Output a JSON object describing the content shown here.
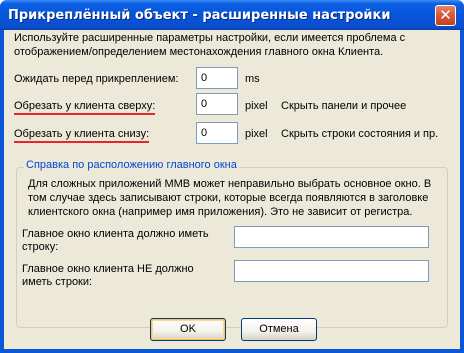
{
  "window": {
    "title": "Прикреплённый объект - расширенные настройки",
    "close_glyph": "✕"
  },
  "intro": "Используйте расширенные параметры настройки, если имеется проблема с отображением/определением местонахождения главного окна Клиента.",
  "wait": {
    "label": "Ожидать перед прикреплением:",
    "value": "0",
    "unit": "ms"
  },
  "crop_top": {
    "label": "Обрезать у клиента сверху:",
    "value": "0",
    "unit": "pixel",
    "hint": "Скрыть панели и прочее"
  },
  "crop_bottom": {
    "label": "Обрезать у клиента снизу:",
    "value": "0",
    "unit": "pixel",
    "hint": "Скрыть строки состояния и пр."
  },
  "group": {
    "title": "Справка по расположению главного окна",
    "description": "Для сложных приложений MMB может неправильно выбрать основное окно. В том случае здесь записывают строки, которые всегда появляются в заголовке клиентского окна (например имя приложения). Это не зависит от регистра.",
    "must_have_label": "Главное окно клиента должно иметь строку:",
    "must_have_value": "",
    "must_not_have_label": "Главное окно клиента НЕ должно иметь строки:",
    "must_not_have_value": ""
  },
  "buttons": {
    "ok": "OK",
    "cancel": "Отмена"
  },
  "colors": {
    "titlebar": "#0655d9",
    "client_bg": "#ece9d8",
    "group_title": "#0046d5",
    "underline": "#e8252b"
  }
}
